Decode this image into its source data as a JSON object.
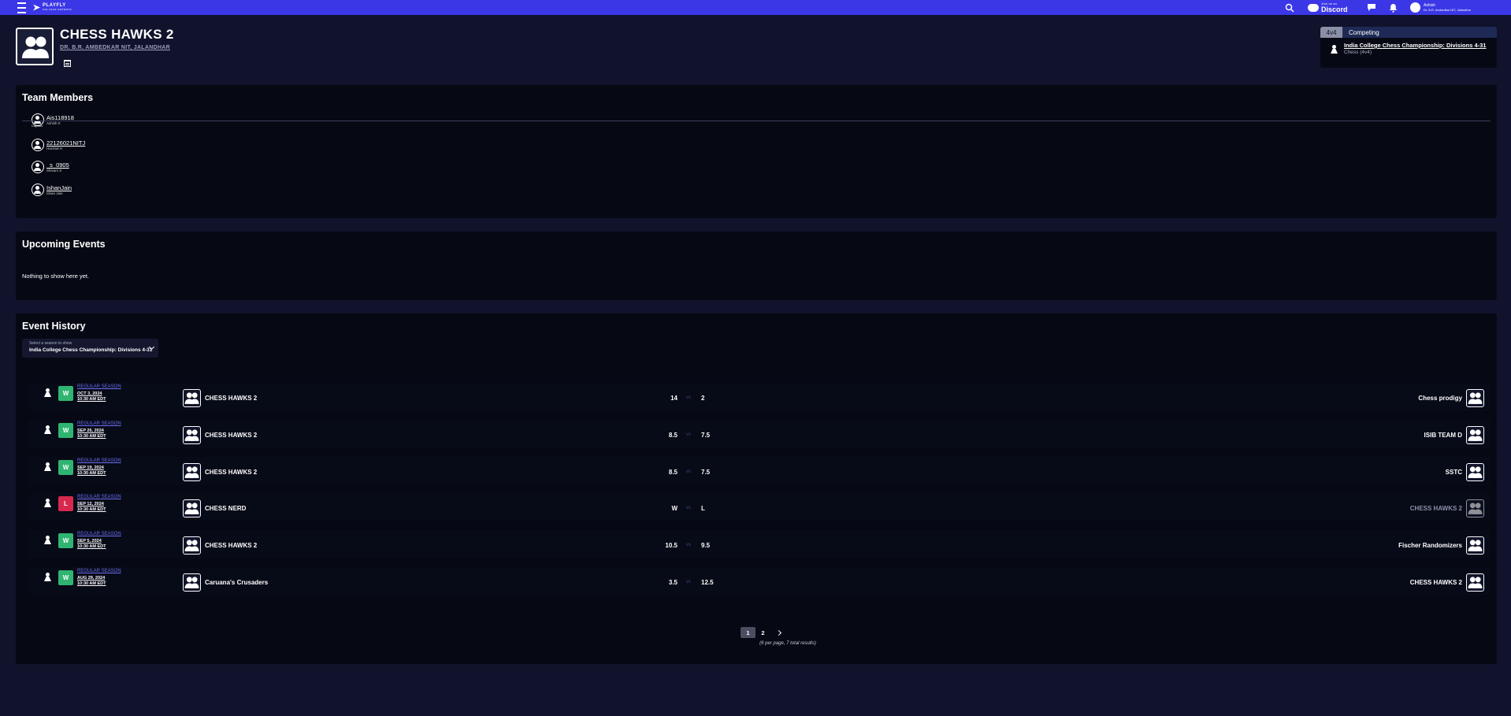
{
  "topbar": {
    "brand": "PLAYFLY",
    "brand_sub": "COLLEGE ESPORTS",
    "discord_small": "Join us on",
    "discord_label": "Discord",
    "user_name": "Ashish",
    "user_school": "Dr. B.R. Ambedkar NIT, Jalandhar"
  },
  "team": {
    "name": "CHESS HAWKS 2",
    "school": "DR. B.R. AMBEDKAR NIT, JALANDHAR"
  },
  "competing": {
    "tag": "4v4",
    "status": "Competing",
    "event_title": "India College Chess Championship: Divisions 4-31",
    "event_sub": "Chess (4v4)"
  },
  "members_panel": {
    "title": "Team Members",
    "captain_label": "Captain",
    "members": [
      {
        "username": "Ais118918",
        "real": "Ashish K"
      },
      {
        "username": "22126021NITJ",
        "real": "Harshal H"
      },
      {
        "username": "_s_0905",
        "real": "Shivam S"
      },
      {
        "username": "IshanJain",
        "real": "Ishan Jain"
      }
    ]
  },
  "upcoming": {
    "title": "Upcoming Events",
    "empty": "Nothing to show here yet."
  },
  "history": {
    "title": "Event History",
    "select_label": "Select a season to show",
    "select_value": "India College Chess Championship: Divisions 4-31",
    "vs": "vs",
    "matches": [
      {
        "result": "W",
        "season": "REGULAR SEASON",
        "date": "OCT 3, 2024",
        "time": "10:30 AM EDT",
        "home": "CHESS HAWKS 2",
        "home_score": "14",
        "away_score": "2",
        "away": "Chess prodigy"
      },
      {
        "result": "W",
        "season": "REGULAR SEASON",
        "date": "SEP 26, 2024",
        "time": "10:30 AM EDT",
        "home": "CHESS HAWKS 2",
        "home_score": "8.5",
        "away_score": "7.5",
        "away": "ISIB TEAM D"
      },
      {
        "result": "W",
        "season": "REGULAR SEASON",
        "date": "SEP 19, 2024",
        "time": "10:30 AM EDT",
        "home": "CHESS HAWKS 2",
        "home_score": "8.5",
        "away_score": "7.5",
        "away": "SSTC"
      },
      {
        "result": "L",
        "season": "REGULAR SEASON",
        "date": "SEP 12, 2024",
        "time": "10:30 AM EDT",
        "home": "CHESS NERD",
        "home_score": "W",
        "away_score": "L",
        "away": "CHESS HAWKS 2"
      },
      {
        "result": "W",
        "season": "REGULAR SEASON",
        "date": "SEP 5, 2024",
        "time": "10:30 AM EDT",
        "home": "CHESS HAWKS 2",
        "home_score": "10.5",
        "away_score": "9.5",
        "away": "Fischer Randomizers"
      },
      {
        "result": "W",
        "season": "REGULAR SEASON",
        "date": "AUG 29, 2024",
        "time": "10:30 AM EDT",
        "home": "Caruana's Crusaders",
        "home_score": "3.5",
        "away_score": "12.5",
        "away": "CHESS HAWKS 2"
      }
    ],
    "pagination": {
      "pages": [
        "1",
        "2"
      ],
      "current": "1",
      "summary": "(6 per page, 7 total results)"
    }
  },
  "colors": {
    "topbar": "#3b37e6",
    "page_bg": "#10132b",
    "panel_bg": "#060914",
    "win": "#2fb571",
    "loss": "#d7294d",
    "link": "#6a6ff0"
  },
  "icons": [
    "menu-icon",
    "search-icon",
    "discord-icon",
    "chat-icon",
    "bell-icon",
    "user-icon",
    "calendar-icon",
    "pawn-icon",
    "team-icon",
    "chevron-down-icon",
    "chevron-right-icon"
  ]
}
